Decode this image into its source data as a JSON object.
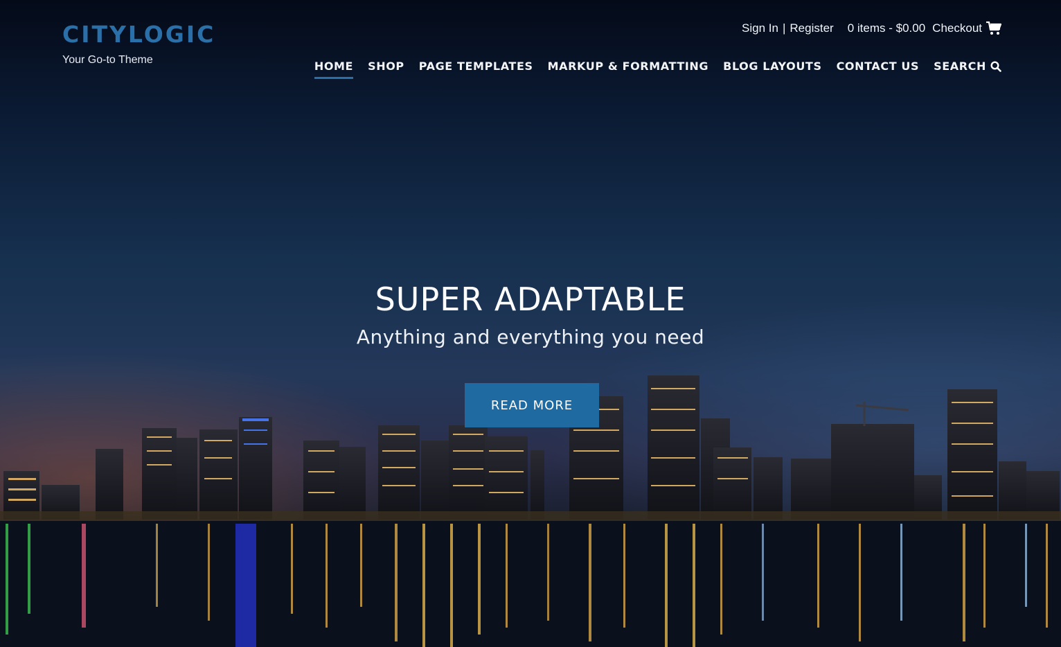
{
  "brand": {
    "title": "CITYLOGIC",
    "tagline": "Your Go-to Theme"
  },
  "topbar": {
    "sign_in": "Sign In",
    "separator": "|",
    "register": "Register",
    "cart_summary": "0 items - $0.00",
    "checkout": "Checkout",
    "cart_icon": "cart-icon"
  },
  "nav": {
    "items": [
      {
        "label": "HOME",
        "active": true
      },
      {
        "label": "SHOP"
      },
      {
        "label": "PAGE TEMPLATES"
      },
      {
        "label": "MARKUP & FORMATTING"
      },
      {
        "label": "BLOG LAYOUTS"
      },
      {
        "label": "CONTACT US"
      },
      {
        "label": "SEARCH",
        "icon": "search-icon"
      }
    ]
  },
  "hero": {
    "title": "SUPER ADAPTABLE",
    "subtitle": "Anything and everything you need",
    "button": "READ MORE"
  },
  "colors": {
    "accent": "#1f6aa0",
    "brand": "#2a6fa8"
  }
}
